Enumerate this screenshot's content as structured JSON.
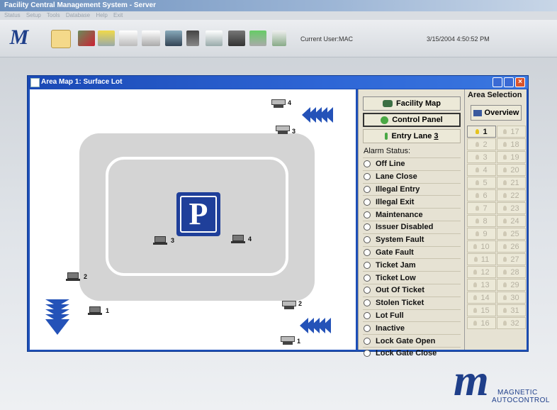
{
  "app": {
    "title": "Facility Central Management System - Server",
    "menu": [
      "Status",
      "Setup",
      "Tools",
      "Database",
      "Help",
      "Exit"
    ],
    "current_user": "Current User:MAC",
    "datetime": "3/15/2004 4:50:52 PM"
  },
  "window": {
    "title": "Area Map 1: Surface Lot",
    "close_glyph": "×"
  },
  "map": {
    "parking_letter": "P",
    "devices": [
      {
        "id": "pc-1",
        "label": "1"
      },
      {
        "id": "pc-2",
        "label": "2"
      },
      {
        "id": "pc-3",
        "label": "3"
      },
      {
        "id": "pc-4",
        "label": "4"
      }
    ],
    "gates": [
      {
        "id": "gate-4",
        "label": "4"
      },
      {
        "id": "gate-3",
        "label": "3"
      },
      {
        "id": "gate-2",
        "label": "2"
      },
      {
        "id": "gate-1",
        "label": "1"
      }
    ]
  },
  "control": {
    "facility_map": "Facility Map",
    "control_panel": "Control Panel",
    "entry_lane": "Entry Lane",
    "entry_lane_number": "3",
    "alarm_title": "Alarm Status:",
    "alarms": [
      "Off Line",
      "Lane Close",
      "Illegal Entry",
      "Illegal Exit",
      "Maintenance",
      "Issuer Disabled",
      "System Fault",
      "Gate Fault",
      "Ticket Jam",
      "Ticket Low",
      "Out Of Ticket",
      "Stolen Ticket",
      "Lot Full",
      "Inactive",
      "Lock Gate Open",
      "Lock Gate Close"
    ]
  },
  "area_selection": {
    "title": "Area Selection",
    "overview": "Overview",
    "areas": [
      "1",
      "17",
      "2",
      "18",
      "3",
      "19",
      "4",
      "20",
      "5",
      "21",
      "6",
      "22",
      "7",
      "23",
      "8",
      "24",
      "9",
      "25",
      "10",
      "26",
      "11",
      "27",
      "12",
      "28",
      "13",
      "29",
      "14",
      "30",
      "15",
      "31",
      "16",
      "32"
    ],
    "active_area": "1"
  },
  "brand": {
    "line1": "MAGNETIC",
    "line2": "AUTOCONTROL"
  },
  "colors": {
    "window_blue": "#1d4fb8",
    "arrow_blue": "#2452b8",
    "parking_sign": "#1f3f9a",
    "lot_gray": "#d4d4d4"
  }
}
